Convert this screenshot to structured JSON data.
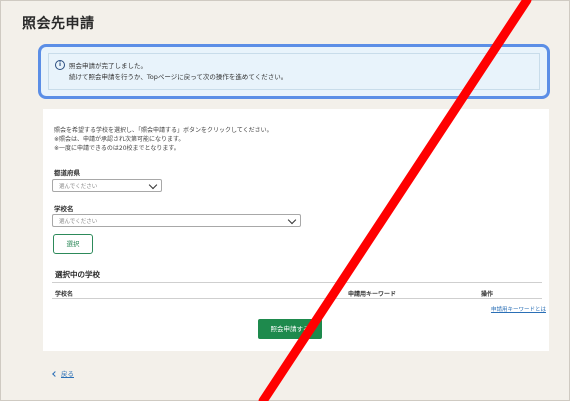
{
  "page": {
    "title": "照会先申請"
  },
  "notice": {
    "icon": "info-icon",
    "line1": "照会申請が完了しました。",
    "line2": "続けて照会申請を行うか、Topページに戻って次の操作を進めてください。"
  },
  "form": {
    "description": [
      "照会を希望する学校を選択し、「照会申請する」ボタンをクリックしてください。",
      "※照会は、申請が承認され次第可能になります。",
      "※一度に申請できるのは20校までとなります。"
    ],
    "prefecture": {
      "label": "都道府県",
      "placeholder": "選んでください"
    },
    "school": {
      "label": "学校名",
      "placeholder": "選んでください"
    },
    "select_button": "選択"
  },
  "selected_schools": {
    "title": "選択中の学校",
    "columns": [
      "学校名",
      "申請用キーワード",
      "操作"
    ],
    "help_link": "申請用キーワードとは"
  },
  "submit_button": "照会申請する",
  "back_link": "戻る",
  "overlay": {
    "color": "#ff0000",
    "meaning": "cross-out"
  }
}
